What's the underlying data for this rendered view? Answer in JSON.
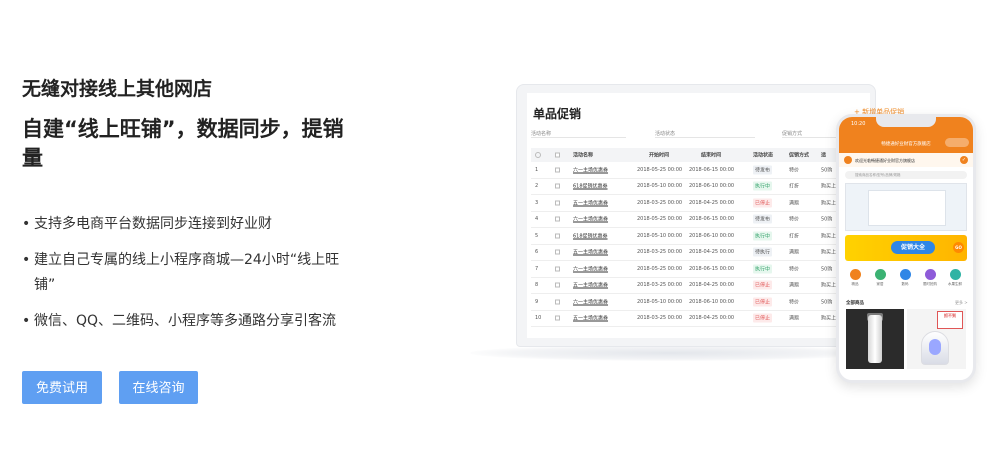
{
  "hero": {
    "subtitle": "无缝对接线上其他网店",
    "title": "自建“线上旺铺”，数据同步，提销量",
    "bullets": [
      "支持多电商平台数据同步连接到好业财",
      "建立自己专属的线上小程序商城—24小时“线上旺铺”",
      "微信、QQ、二维码、小程序等多通路分享引客流"
    ],
    "bullet_marker": "•",
    "buttons": {
      "trial": "免费试用",
      "consult": "在线咨询"
    },
    "button_color": "#5f9ff2"
  },
  "laptop": {
    "title": "单品促销",
    "add_link": "+ 新增单品促销",
    "filters": [
      "活动名称",
      "活动状态",
      "促销方式"
    ],
    "columns": [
      "",
      "",
      "活动名称",
      "开始时间",
      "结束时间",
      "活动状态",
      "促销方式",
      "适"
    ],
    "rows": [
      {
        "no": "1",
        "name": "六一主场优惠券",
        "start": "2018-05-25 00:00",
        "end": "2018-06-15 00:00",
        "status": "待发布",
        "status_type": "pending",
        "method": "特价",
        "extra": "50购"
      },
      {
        "no": "2",
        "name": "618促销优惠券",
        "start": "2018-05-10 00:00",
        "end": "2018-06-10 00:00",
        "status": "执行中",
        "status_type": "running",
        "method": "打折",
        "extra": "购买上"
      },
      {
        "no": "3",
        "name": "五一主场优惠券",
        "start": "2018-03-25 00:00",
        "end": "2018-04-25 00:00",
        "status": "已停止",
        "status_type": "stopped",
        "method": "满赠",
        "extra": "购买上"
      },
      {
        "no": "4",
        "name": "六一主场优惠券",
        "start": "2018-05-25 00:00",
        "end": "2018-06-15 00:00",
        "status": "待发布",
        "status_type": "pending",
        "method": "特价",
        "extra": "50购"
      },
      {
        "no": "5",
        "name": "618促销优惠券",
        "start": "2018-05-10 00:00",
        "end": "2018-06-10 00:00",
        "status": "执行中",
        "status_type": "running",
        "method": "打折",
        "extra": "购买上"
      },
      {
        "no": "6",
        "name": "五一主场优惠券",
        "start": "2018-03-25 00:00",
        "end": "2018-04-25 00:00",
        "status": "待执行",
        "status_type": "pending",
        "method": "满赠",
        "extra": "购买上"
      },
      {
        "no": "7",
        "name": "六一主场优惠券",
        "start": "2018-05-25 00:00",
        "end": "2018-06-15 00:00",
        "status": "执行中",
        "status_type": "running",
        "method": "特价",
        "extra": "50购"
      },
      {
        "no": "8",
        "name": "五一主场优惠券",
        "start": "2018-03-25 00:00",
        "end": "2018-04-25 00:00",
        "status": "已停止",
        "status_type": "stopped",
        "method": "满赠",
        "extra": "购买上"
      },
      {
        "no": "9",
        "name": "六一主场优惠券",
        "start": "2018-05-10 00:00",
        "end": "2018-06-10 00:00",
        "status": "已停止",
        "status_type": "stopped",
        "method": "特价",
        "extra": "50购"
      },
      {
        "no": "10",
        "name": "五一主场优惠券",
        "start": "2018-03-25 00:00",
        "end": "2018-04-25 00:00",
        "status": "已停止",
        "status_type": "stopped",
        "method": "满赠",
        "extra": "购买上"
      }
    ]
  },
  "phone": {
    "time": "10:20",
    "title": "畅捷通好业财官方旗舰店",
    "shop_name": "欢迎光临畅捷通好业财官方旗舰店",
    "search_placeholder": "搜索商品名称/型号/品牌/规格",
    "promo_label": "促销大全",
    "promo_go": "GO",
    "categories": [
      {
        "label": "精品",
        "color": "#f0821e"
      },
      {
        "label": "家居",
        "color": "#3bb273"
      },
      {
        "label": "数码",
        "color": "#2f86e6"
      },
      {
        "label": "限时抢购",
        "color": "#8e5bd9"
      },
      {
        "label": "水果生鲜",
        "color": "#2fb3a4"
      }
    ],
    "section_title": "全部商品",
    "more": "更多 >",
    "goods_tag": "抓不到",
    "accent_color": "#f0821e"
  }
}
